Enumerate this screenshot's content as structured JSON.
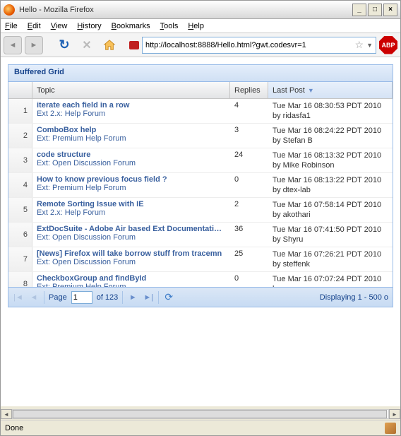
{
  "window": {
    "title": "Hello - Mozilla Firefox"
  },
  "menubar": {
    "items": [
      "File",
      "Edit",
      "View",
      "History",
      "Bookmarks",
      "Tools",
      "Help"
    ]
  },
  "urlbar": {
    "value": "http://localhost:8888/Hello.html?gwt.codesvr=1"
  },
  "abp": {
    "label": "ABP"
  },
  "panel": {
    "title": "Buffered Grid"
  },
  "columns": {
    "topic": "Topic",
    "replies": "Replies",
    "lastpost": "Last Post"
  },
  "rows": [
    {
      "n": "1",
      "title": "iterate each field in a row",
      "forum": "Ext 2.x: Help Forum",
      "replies": "4",
      "date": "Tue Mar 16 08:30:53 PDT 2010",
      "by": "by ridasfa1"
    },
    {
      "n": "2",
      "title": "ComboBox help",
      "forum": "Ext: Premium Help Forum",
      "replies": "3",
      "date": "Tue Mar 16 08:24:22 PDT 2010",
      "by": "by Stefan B"
    },
    {
      "n": "3",
      "title": "code structure",
      "forum": "Ext: Open Discussion Forum",
      "replies": "24",
      "date": "Tue Mar 16 08:13:32 PDT 2010",
      "by": "by Mike Robinson"
    },
    {
      "n": "4",
      "title": "How to know previous focus field ?",
      "forum": "Ext: Premium Help Forum",
      "replies": "0",
      "date": "Tue Mar 16 08:13:22 PDT 2010",
      "by": "by dtex-lab"
    },
    {
      "n": "5",
      "title": "Remote Sorting Issue with IE",
      "forum": "Ext 2.x: Help Forum",
      "replies": "2",
      "date": "Tue Mar 16 07:58:14 PDT 2010",
      "by": "by akothari"
    },
    {
      "n": "6",
      "title": "ExtDocSuite - Adobe Air based Ext Documentation a",
      "forum": "Ext: Open Discussion Forum",
      "replies": "36",
      "date": "Tue Mar 16 07:41:50 PDT 2010",
      "by": "by Shyru"
    },
    {
      "n": "7",
      "title": "[News] Firefox will take borrow stuff from tracemn",
      "forum": "Ext: Open Discussion Forum",
      "replies": "25",
      "date": "Tue Mar 16 07:26:21 PDT 2010",
      "by": "by steffenk"
    },
    {
      "n": "8",
      "title": "CheckboxGroup and findById",
      "forum": "Ext: Premium Help Forum",
      "replies": "0",
      "date": "Tue Mar 16 07:07:24 PDT 2010",
      "by": "by ..."
    }
  ],
  "paging": {
    "page_label": "Page",
    "page_value": "1",
    "total_label": "of 123",
    "display_text": "Displaying 1 - 500 o"
  },
  "status": {
    "text": "Done"
  }
}
